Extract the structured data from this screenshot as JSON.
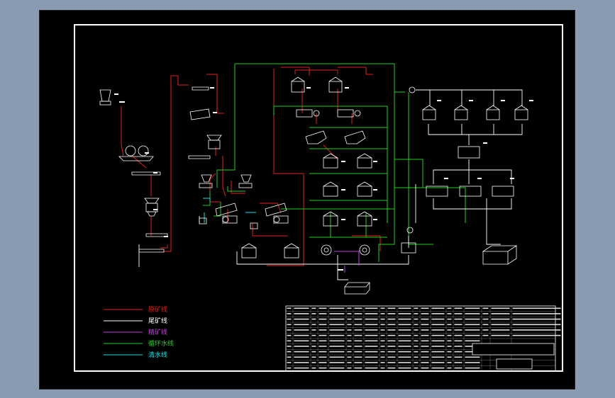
{
  "legend": {
    "items": [
      {
        "label": "原矿线",
        "color": "#e02020"
      },
      {
        "label": "尾矿线",
        "color": "#ffffff"
      },
      {
        "label": "精矿线",
        "color": "#c040e0"
      },
      {
        "label": "循环水线",
        "color": "#20d020"
      },
      {
        "label": "清水线",
        "color": "#20e0e0"
      }
    ]
  },
  "colors": {
    "background_outer": "#8a9bb1",
    "canvas": "#000000",
    "frame": "#ffffff",
    "ore_line": "#e02020",
    "tailings_line": "#ffffff",
    "concentrate_line": "#c040e0",
    "circulating_water_line": "#20d020",
    "clear_water_line": "#20e0e0"
  }
}
